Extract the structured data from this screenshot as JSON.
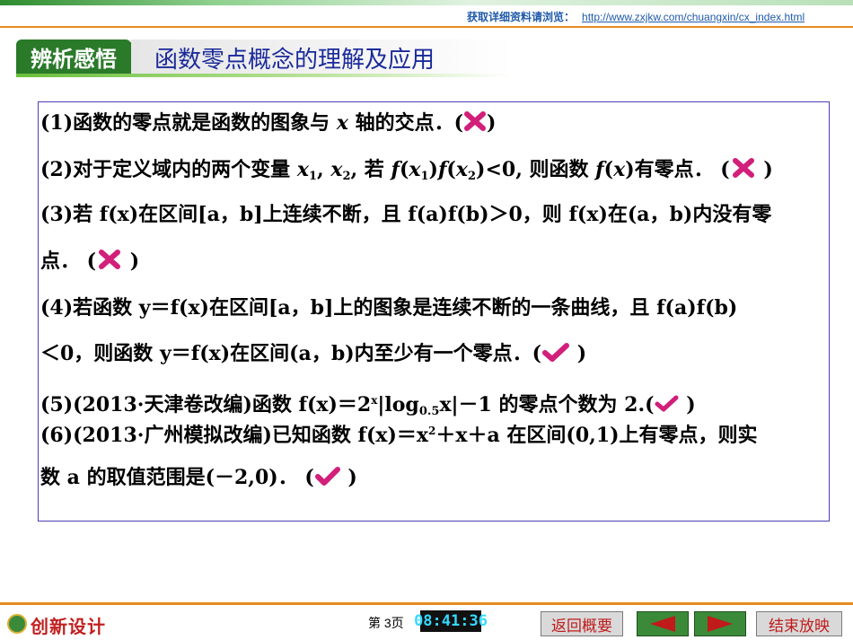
{
  "header": {
    "link_label": "获取详细资料请浏览：",
    "link_url": "http://www.zxjkw.com/chuangxin/cx_index.html"
  },
  "section": {
    "badge": "辨析感悟",
    "title": "函数零点概念的理解及应用"
  },
  "items": {
    "i1": {
      "num": "(1)",
      "text_a": "函数的零点就是函数的图象与 ",
      "x": "x",
      "text_b": " 轴的交点．",
      "mark": "cross"
    },
    "i2": {
      "num": "(2)",
      "text_a": "对于定义域内的两个变量 ",
      "x1": "x",
      "s1": "1",
      "comma": ", ",
      "x2": "x",
      "s2": "2",
      "text_b": ", 若 ",
      "f1": "f",
      "p1": "(",
      "xx1": "x",
      "ss1": "1",
      "p2": ")",
      "f2": "f",
      "p3": "(",
      "xx2": "x",
      "ss2": "2",
      "p4": ")",
      "text_c": "<0",
      "text_d": ", 则函数 ",
      "f3": "f",
      "p5": "(",
      "x3": "x",
      "p6": ")",
      "text_e": "有零点．",
      "mark": "cross"
    },
    "i3_line1": "(3)若 f(x)在区间[a，b]上连续不断，且 f(a)f(b)＞0，则 f(x)在(a，b)内没有零",
    "i3_line2": "点．",
    "i3_mark": "cross",
    "i4_line1": "(4)若函数 y＝f(x)在区间[a，b]上的图象是连续不断的一条曲线，且 f(a)f(b)",
    "i4_line2": "＜0，则函数 y＝f(x)在区间(a，b)内至少有一个零点．",
    "i4_mark": "check",
    "i5_a": "(5)(2013·",
    "i5_src": "天津卷改编",
    "i5_b": ")函数 f(x)＝2",
    "i5_sup": "x",
    "i5_c": "|log",
    "i5_sub": "0.5",
    "i5_d": "x|－1 的零点个数为 2.",
    "i5_mark": "check",
    "i6_a": "(6)(2013·",
    "i6_src": "广州模拟改编",
    "i6_b": ")已知函数 f(x)＝x",
    "i6_sup": "2",
    "i6_c": "＋x＋a 在区间(0,1)上有零点，则实",
    "i6_line2": "数 a 的取值范围是(－2,0)．",
    "i6_mark": "check"
  },
  "footer": {
    "logo_text": "创新设计",
    "page": "第 3页",
    "clock": "08:41:36",
    "back_button": "返回概要",
    "end_button": "结束放映"
  },
  "colors": {
    "accent_green": "#2a7a2a",
    "title_blue": "#1a2a9a",
    "mark_pink": "#d21f7a",
    "border_purple": "#4b3fb5"
  }
}
